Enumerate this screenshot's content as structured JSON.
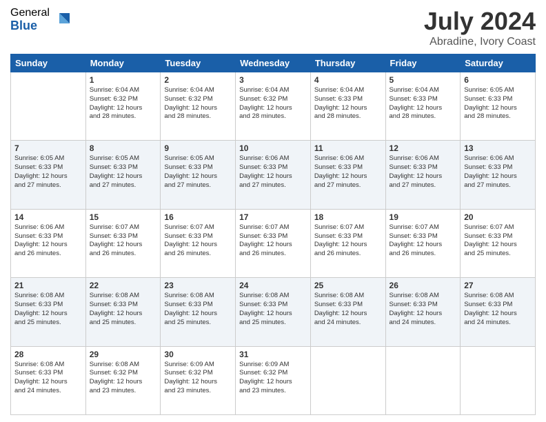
{
  "logo": {
    "general": "General",
    "blue": "Blue"
  },
  "title": "July 2024",
  "location": "Abradine, Ivory Coast",
  "days": [
    "Sunday",
    "Monday",
    "Tuesday",
    "Wednesday",
    "Thursday",
    "Friday",
    "Saturday"
  ],
  "weeks": [
    [
      {
        "num": "",
        "info": ""
      },
      {
        "num": "1",
        "info": "Sunrise: 6:04 AM\nSunset: 6:32 PM\nDaylight: 12 hours\nand 28 minutes."
      },
      {
        "num": "2",
        "info": "Sunrise: 6:04 AM\nSunset: 6:32 PM\nDaylight: 12 hours\nand 28 minutes."
      },
      {
        "num": "3",
        "info": "Sunrise: 6:04 AM\nSunset: 6:32 PM\nDaylight: 12 hours\nand 28 minutes."
      },
      {
        "num": "4",
        "info": "Sunrise: 6:04 AM\nSunset: 6:33 PM\nDaylight: 12 hours\nand 28 minutes."
      },
      {
        "num": "5",
        "info": "Sunrise: 6:04 AM\nSunset: 6:33 PM\nDaylight: 12 hours\nand 28 minutes."
      },
      {
        "num": "6",
        "info": "Sunrise: 6:05 AM\nSunset: 6:33 PM\nDaylight: 12 hours\nand 28 minutes."
      }
    ],
    [
      {
        "num": "7",
        "info": "Sunrise: 6:05 AM\nSunset: 6:33 PM\nDaylight: 12 hours\nand 27 minutes."
      },
      {
        "num": "8",
        "info": "Sunrise: 6:05 AM\nSunset: 6:33 PM\nDaylight: 12 hours\nand 27 minutes."
      },
      {
        "num": "9",
        "info": "Sunrise: 6:05 AM\nSunset: 6:33 PM\nDaylight: 12 hours\nand 27 minutes."
      },
      {
        "num": "10",
        "info": "Sunrise: 6:06 AM\nSunset: 6:33 PM\nDaylight: 12 hours\nand 27 minutes."
      },
      {
        "num": "11",
        "info": "Sunrise: 6:06 AM\nSunset: 6:33 PM\nDaylight: 12 hours\nand 27 minutes."
      },
      {
        "num": "12",
        "info": "Sunrise: 6:06 AM\nSunset: 6:33 PM\nDaylight: 12 hours\nand 27 minutes."
      },
      {
        "num": "13",
        "info": "Sunrise: 6:06 AM\nSunset: 6:33 PM\nDaylight: 12 hours\nand 27 minutes."
      }
    ],
    [
      {
        "num": "14",
        "info": "Sunrise: 6:06 AM\nSunset: 6:33 PM\nDaylight: 12 hours\nand 26 minutes."
      },
      {
        "num": "15",
        "info": "Sunrise: 6:07 AM\nSunset: 6:33 PM\nDaylight: 12 hours\nand 26 minutes."
      },
      {
        "num": "16",
        "info": "Sunrise: 6:07 AM\nSunset: 6:33 PM\nDaylight: 12 hours\nand 26 minutes."
      },
      {
        "num": "17",
        "info": "Sunrise: 6:07 AM\nSunset: 6:33 PM\nDaylight: 12 hours\nand 26 minutes."
      },
      {
        "num": "18",
        "info": "Sunrise: 6:07 AM\nSunset: 6:33 PM\nDaylight: 12 hours\nand 26 minutes."
      },
      {
        "num": "19",
        "info": "Sunrise: 6:07 AM\nSunset: 6:33 PM\nDaylight: 12 hours\nand 26 minutes."
      },
      {
        "num": "20",
        "info": "Sunrise: 6:07 AM\nSunset: 6:33 PM\nDaylight: 12 hours\nand 25 minutes."
      }
    ],
    [
      {
        "num": "21",
        "info": "Sunrise: 6:08 AM\nSunset: 6:33 PM\nDaylight: 12 hours\nand 25 minutes."
      },
      {
        "num": "22",
        "info": "Sunrise: 6:08 AM\nSunset: 6:33 PM\nDaylight: 12 hours\nand 25 minutes."
      },
      {
        "num": "23",
        "info": "Sunrise: 6:08 AM\nSunset: 6:33 PM\nDaylight: 12 hours\nand 25 minutes."
      },
      {
        "num": "24",
        "info": "Sunrise: 6:08 AM\nSunset: 6:33 PM\nDaylight: 12 hours\nand 25 minutes."
      },
      {
        "num": "25",
        "info": "Sunrise: 6:08 AM\nSunset: 6:33 PM\nDaylight: 12 hours\nand 24 minutes."
      },
      {
        "num": "26",
        "info": "Sunrise: 6:08 AM\nSunset: 6:33 PM\nDaylight: 12 hours\nand 24 minutes."
      },
      {
        "num": "27",
        "info": "Sunrise: 6:08 AM\nSunset: 6:33 PM\nDaylight: 12 hours\nand 24 minutes."
      }
    ],
    [
      {
        "num": "28",
        "info": "Sunrise: 6:08 AM\nSunset: 6:33 PM\nDaylight: 12 hours\nand 24 minutes."
      },
      {
        "num": "29",
        "info": "Sunrise: 6:08 AM\nSunset: 6:32 PM\nDaylight: 12 hours\nand 23 minutes."
      },
      {
        "num": "30",
        "info": "Sunrise: 6:09 AM\nSunset: 6:32 PM\nDaylight: 12 hours\nand 23 minutes."
      },
      {
        "num": "31",
        "info": "Sunrise: 6:09 AM\nSunset: 6:32 PM\nDaylight: 12 hours\nand 23 minutes."
      },
      {
        "num": "",
        "info": ""
      },
      {
        "num": "",
        "info": ""
      },
      {
        "num": "",
        "info": ""
      }
    ]
  ]
}
